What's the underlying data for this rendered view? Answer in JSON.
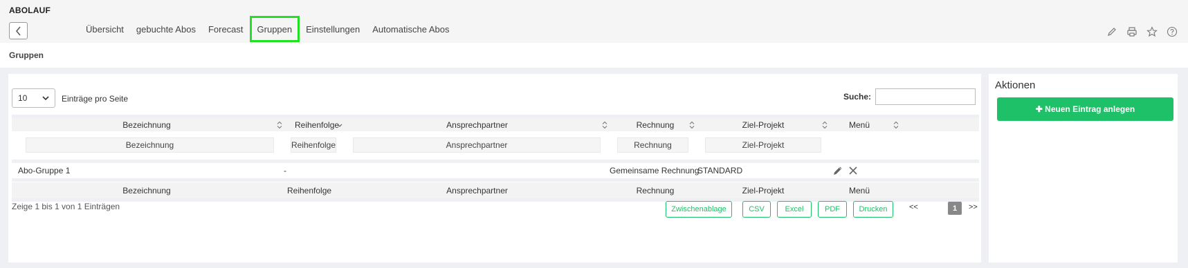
{
  "app": {
    "title": "ABOLAUF"
  },
  "tabs": [
    {
      "label": "Übersicht"
    },
    {
      "label": "gebuchte Abos"
    },
    {
      "label": "Forecast"
    },
    {
      "label": "Gruppen",
      "active": true
    },
    {
      "label": "Einstellungen"
    },
    {
      "label": "Automatische Abos"
    }
  ],
  "toolbar_icons": [
    "pencil-icon",
    "printer-icon",
    "star-icon",
    "help-icon"
  ],
  "page": {
    "subtitle": "Gruppen"
  },
  "table_controls": {
    "page_length": "10",
    "page_length_label": "Einträge pro Seite",
    "search_label": "Suche:",
    "search_value": ""
  },
  "columns": [
    "Bezeichnung",
    "Reihenfolge",
    "Ansprechpartner",
    "Rechnung",
    "Ziel-Projekt",
    "Menü"
  ],
  "filters": [
    "Bezeichnung",
    "Reihenfolge",
    "Ansprechpartner",
    "Rechnung",
    "Ziel-Projekt"
  ],
  "rows": [
    {
      "bezeichnung": "Abo-Gruppe 1",
      "reihenfolge": "-",
      "ansprechpartner": "",
      "rechnung": "Gemeinsame Rechnung",
      "ziel_projekt": "STANDARD"
    }
  ],
  "footer": {
    "info": "Zeige 1 bis 1 von 1 Einträgen",
    "buttons": [
      "Zwischenablage",
      "CSV",
      "Excel",
      "PDF",
      "Drucken"
    ],
    "pagination": {
      "prev": "<<",
      "current": "1",
      "next": ">>"
    }
  },
  "side": {
    "title": "Aktionen",
    "new_entry": "✚ Neuen Eintrag anlegen"
  },
  "colors": {
    "accent": "#1ec167",
    "active_tab_border": "#22e022"
  }
}
